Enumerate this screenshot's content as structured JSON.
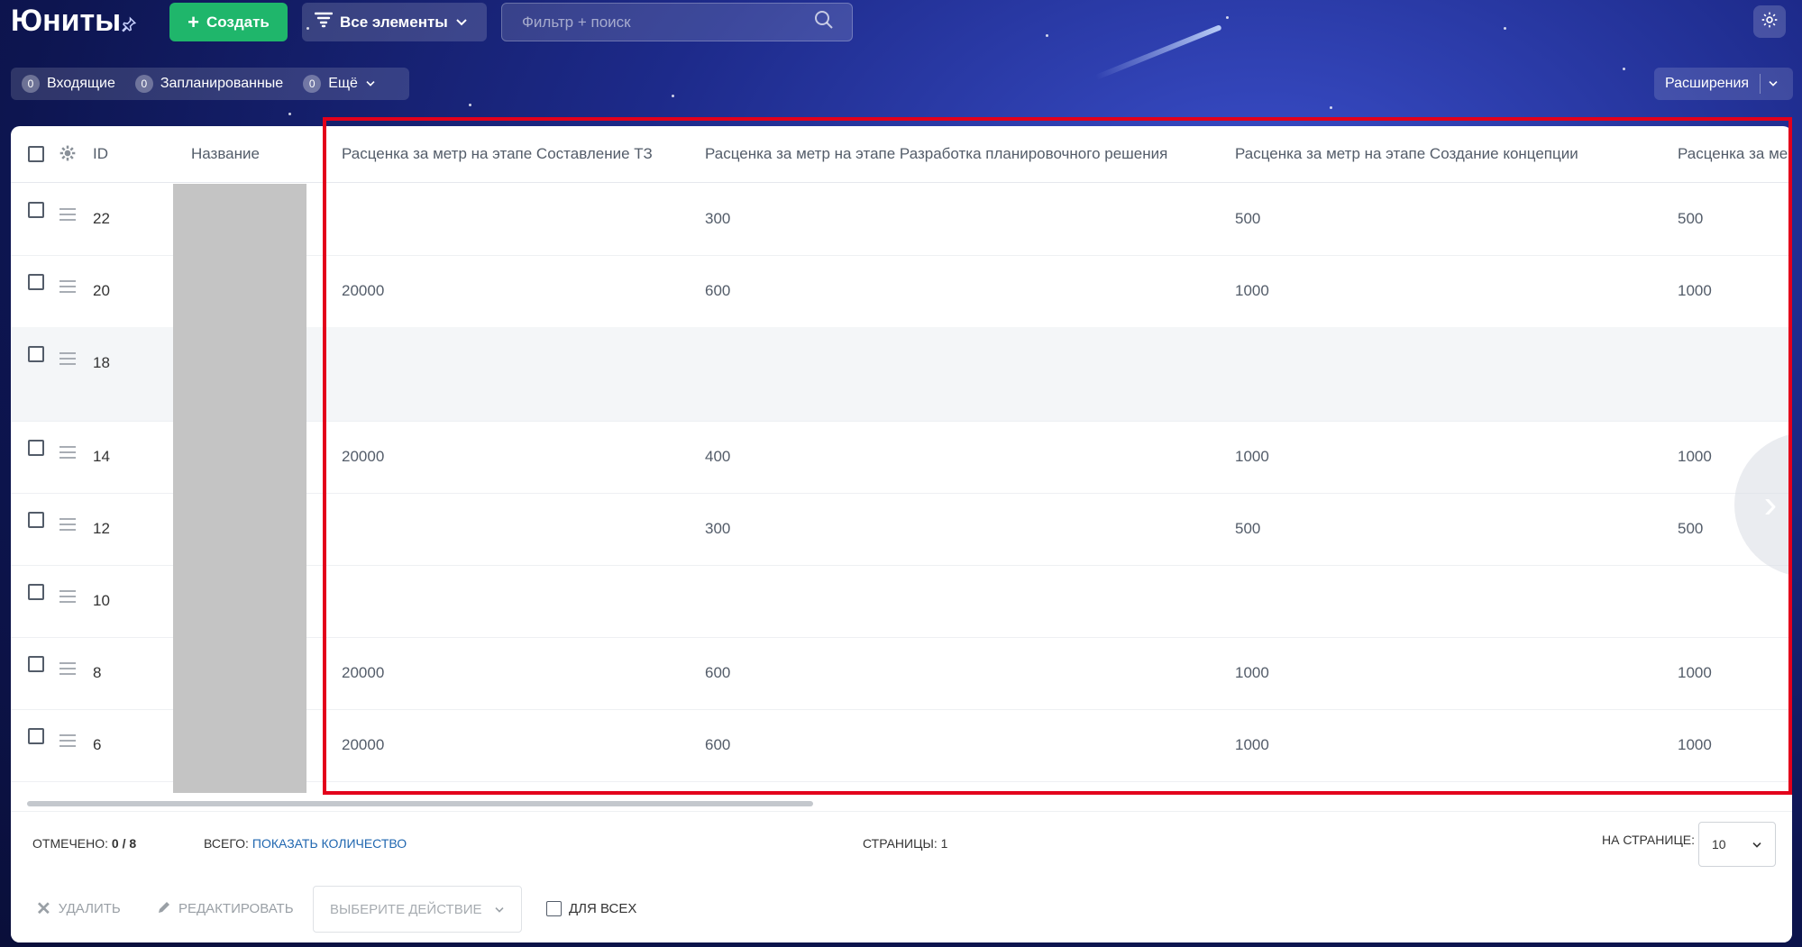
{
  "header": {
    "title": "Юниты",
    "create_label": "Создать",
    "filter_label": "Все элементы",
    "search_placeholder": "Фильтр + поиск"
  },
  "counters": [
    {
      "count": "0",
      "label": "Входящие"
    },
    {
      "count": "0",
      "label": "Запланированные"
    },
    {
      "count": "0",
      "label": "Ещё"
    }
  ],
  "extensions_label": "Расширения",
  "table": {
    "columns": {
      "id": "ID",
      "name": "Название",
      "c1": "Расценка за метр на этапе Составление ТЗ",
      "c2": "Расценка за метр на этапе Разработка планировочного решения",
      "c3": "Расценка за метр на этапе Создание концепции",
      "c4": "Расценка за ме"
    },
    "rows": [
      {
        "id": "22",
        "c1": "",
        "c2": "300",
        "c3": "500",
        "c4": "500"
      },
      {
        "id": "20",
        "c1": "20000",
        "c2": "600",
        "c3": "1000",
        "c4": "1000"
      },
      {
        "id": "18",
        "c1": "",
        "c2": "",
        "c3": "",
        "c4": ""
      },
      {
        "id": "14",
        "c1": "20000",
        "c2": "400",
        "c3": "1000",
        "c4": "1000"
      },
      {
        "id": "12",
        "c1": "",
        "c2": "300",
        "c3": "500",
        "c4": "500"
      },
      {
        "id": "10",
        "c1": "",
        "c2": "",
        "c3": "",
        "c4": ""
      },
      {
        "id": "8",
        "c1": "20000",
        "c2": "600",
        "c3": "1000",
        "c4": "1000"
      },
      {
        "id": "6",
        "c1": "20000",
        "c2": "600",
        "c3": "1000",
        "c4": "1000"
      }
    ]
  },
  "footer": {
    "selected_label": "Отмечено:",
    "selected_value": "0 / 8",
    "total_label": "Всего:",
    "show_count_link": "Показать количество",
    "pages_label": "Страницы:",
    "pages_value": "1",
    "per_page_label": "На странице:",
    "per_page_value": "10",
    "delete_label": "Удалить",
    "edit_label": "Редактировать",
    "action_placeholder": "Выберите действие",
    "for_all_label": "Для всех"
  }
}
